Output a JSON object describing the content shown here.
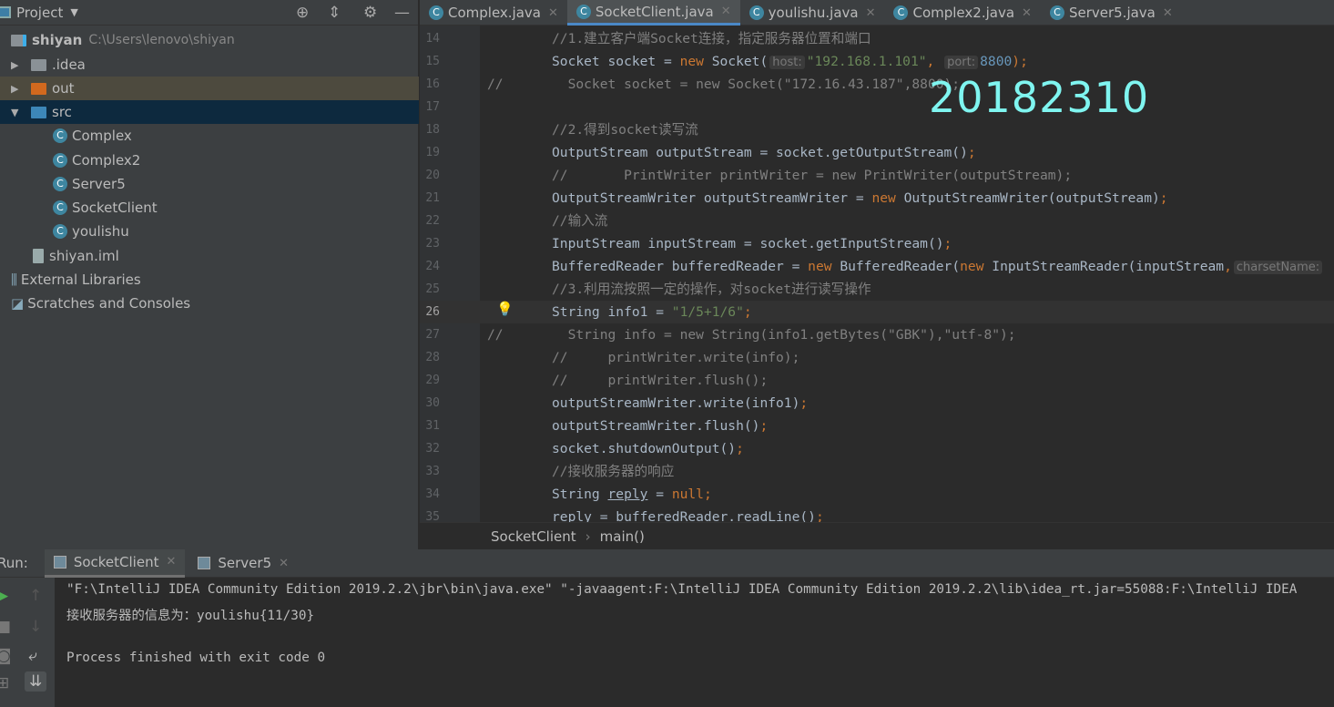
{
  "project_panel": {
    "title": "Project",
    "tree": [
      {
        "label": "shiyan",
        "path": "C:\\Users\\lenovo\\shiyan",
        "type": "module"
      },
      {
        "label": ".idea",
        "type": "folder"
      },
      {
        "label": "out",
        "type": "folder-excluded"
      },
      {
        "label": "src",
        "type": "folder-source",
        "expanded": true,
        "selected": true
      },
      {
        "label": "Complex",
        "type": "class"
      },
      {
        "label": "Complex2",
        "type": "class"
      },
      {
        "label": "Server5",
        "type": "class"
      },
      {
        "label": "SocketClient",
        "type": "class"
      },
      {
        "label": "youlishu",
        "type": "class"
      },
      {
        "label": "shiyan.iml",
        "type": "file"
      },
      {
        "label": "External Libraries",
        "type": "libraries"
      },
      {
        "label": "Scratches and Consoles",
        "type": "scratches"
      }
    ]
  },
  "editor_tabs": [
    {
      "label": "Complex.java",
      "active": false
    },
    {
      "label": "SocketClient.java",
      "active": true
    },
    {
      "label": "youlishu.java",
      "active": false
    },
    {
      "label": "Complex2.java",
      "active": false
    },
    {
      "label": "Server5.java",
      "active": false
    }
  ],
  "code_lines": [
    {
      "n": "14",
      "segs": [
        [
          "//1.建立客户端Socket连接，指定服务器位置和端口",
          "cmt"
        ]
      ]
    },
    {
      "n": "15",
      "segs": [
        [
          "Socket socket = ",
          "plain"
        ],
        [
          "new ",
          "kw"
        ],
        [
          "Socket(",
          "plain"
        ],
        [
          "host:",
          "hint"
        ],
        [
          "\"192.168.1.101\"",
          "str"
        ],
        [
          ", ",
          "kw"
        ],
        [
          "port:",
          "hint"
        ],
        [
          "8800",
          "num"
        ],
        [
          ");",
          "kw"
        ]
      ]
    },
    {
      "n": "16",
      "slash": "//",
      "segs": [
        [
          "  Socket socket = new Socket(\"172.16.43.187\",8800);",
          "cmt"
        ]
      ]
    },
    {
      "n": "17",
      "segs": []
    },
    {
      "n": "18",
      "segs": [
        [
          "//2.得到socket读写流",
          "cmt"
        ]
      ]
    },
    {
      "n": "19",
      "segs": [
        [
          "OutputStream outputStream = socket.getOutputStream()",
          "plain"
        ],
        [
          ";",
          "kw"
        ]
      ]
    },
    {
      "n": "20",
      "segs": [
        [
          "//       PrintWriter printWriter = new PrintWriter(outputStream);",
          "cmt"
        ]
      ]
    },
    {
      "n": "21",
      "segs": [
        [
          "OutputStreamWriter outputStreamWriter = ",
          "plain"
        ],
        [
          "new ",
          "kw"
        ],
        [
          "OutputStreamWriter(outputStream)",
          "plain"
        ],
        [
          ";",
          "kw"
        ]
      ]
    },
    {
      "n": "22",
      "segs": [
        [
          "//输入流",
          "cmt"
        ]
      ]
    },
    {
      "n": "23",
      "segs": [
        [
          "InputStream inputStream = socket.getInputStream()",
          "plain"
        ],
        [
          ";",
          "kw"
        ]
      ]
    },
    {
      "n": "24",
      "segs": [
        [
          "BufferedReader bufferedReader = ",
          "plain"
        ],
        [
          "new ",
          "kw"
        ],
        [
          "BufferedReader(",
          "plain"
        ],
        [
          "new ",
          "kw"
        ],
        [
          "InputStreamReader(inputStream",
          "plain"
        ],
        [
          ",",
          "kw"
        ],
        [
          "charsetName:",
          "hint"
        ]
      ]
    },
    {
      "n": "25",
      "segs": [
        [
          "//3.利用流按照一定的操作，对socket进行读写操作",
          "cmt"
        ]
      ]
    },
    {
      "n": "26",
      "current": true,
      "segs": [
        [
          "String info1 = ",
          "plain"
        ],
        [
          "\"1/5+1/6\"",
          "str"
        ],
        [
          ";",
          "kw"
        ]
      ]
    },
    {
      "n": "27",
      "slash": "//",
      "segs": [
        [
          "  String info = new String(info1.getBytes(\"GBK\"),\"utf-8\");",
          "cmt"
        ]
      ]
    },
    {
      "n": "28",
      "segs": [
        [
          "//     printWriter.write(info);",
          "cmt"
        ]
      ]
    },
    {
      "n": "29",
      "segs": [
        [
          "//     printWriter.flush();",
          "cmt"
        ]
      ]
    },
    {
      "n": "30",
      "segs": [
        [
          "outputStreamWriter.write(info1)",
          "plain"
        ],
        [
          ";",
          "kw"
        ]
      ]
    },
    {
      "n": "31",
      "segs": [
        [
          "outputStreamWriter.flush()",
          "plain"
        ],
        [
          ";",
          "kw"
        ]
      ]
    },
    {
      "n": "32",
      "segs": [
        [
          "socket.shutdownOutput()",
          "plain"
        ],
        [
          ";",
          "kw"
        ]
      ]
    },
    {
      "n": "33",
      "segs": [
        [
          "//接收服务器的响应",
          "cmt"
        ]
      ]
    },
    {
      "n": "34",
      "segs": [
        [
          "String ",
          "plain"
        ],
        [
          "reply",
          "ul plain"
        ],
        [
          " = ",
          "plain"
        ],
        [
          "null",
          "kw"
        ],
        [
          ";",
          "kw"
        ]
      ]
    },
    {
      "n": "35",
      "segs": [
        [
          "reply = bufferedReader.readLine()",
          "plain"
        ],
        [
          ";",
          "kw"
        ]
      ]
    }
  ],
  "watermark": "20182310",
  "breadcrumb": [
    "SocketClient",
    "main()"
  ],
  "run_panel": {
    "label": "Run:",
    "tabs": [
      {
        "label": "SocketClient",
        "active": true
      },
      {
        "label": "Server5",
        "active": false
      }
    ],
    "output": [
      "\"F:\\IntelliJ IDEA Community Edition 2019.2.2\\jbr\\bin\\java.exe\" \"-javaagent:F:\\IntelliJ IDEA Community Edition 2019.2.2\\lib\\idea_rt.jar=55088:F:\\IntelliJ IDEA",
      "接收服务器的信息为：youlishu{11/30}",
      "",
      "Process finished with exit code 0"
    ]
  }
}
